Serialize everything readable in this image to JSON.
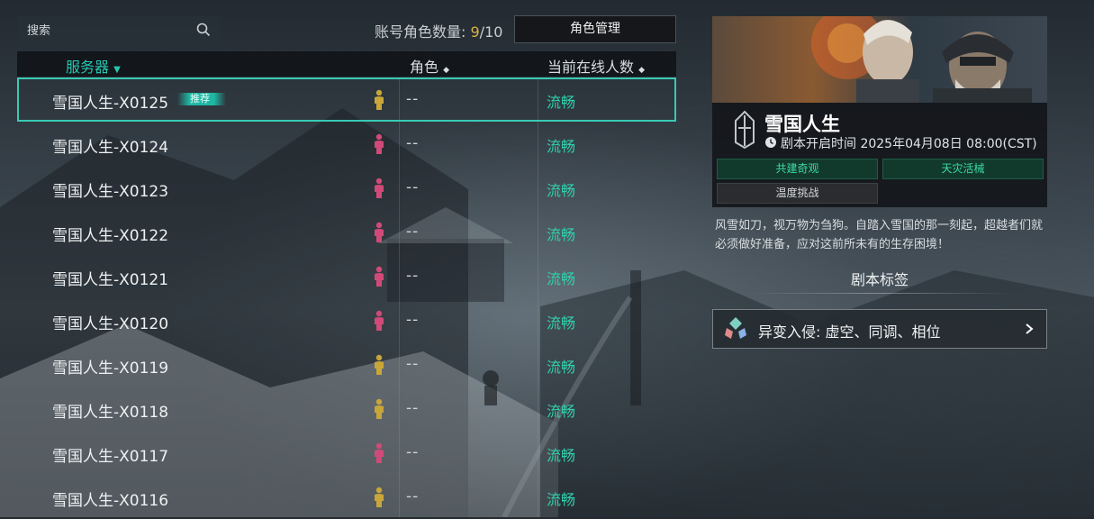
{
  "search": {
    "placeholder": "搜索"
  },
  "account": {
    "label": "账号角色数量: ",
    "current": "9",
    "sep": "/",
    "max": "10"
  },
  "manage_button": "角色管理",
  "table": {
    "headers": {
      "server": "服务器",
      "role": "角色",
      "online": "当前在线人数"
    },
    "rows": [
      {
        "name": "雪国人生-X0125",
        "tag": "推荐",
        "role": "--",
        "status": "流畅",
        "figure_color": "#c8a63a",
        "selected": true
      },
      {
        "name": "雪国人生-X0124",
        "tag": "",
        "role": "--",
        "status": "流畅",
        "figure_color": "#d04a78",
        "selected": false
      },
      {
        "name": "雪国人生-X0123",
        "tag": "",
        "role": "--",
        "status": "流畅",
        "figure_color": "#d04a78",
        "selected": false
      },
      {
        "name": "雪国人生-X0122",
        "tag": "",
        "role": "--",
        "status": "流畅",
        "figure_color": "#d04a78",
        "selected": false
      },
      {
        "name": "雪国人生-X0121",
        "tag": "",
        "role": "--",
        "status": "流畅",
        "figure_color": "#d04a78",
        "selected": false
      },
      {
        "name": "雪国人生-X0120",
        "tag": "",
        "role": "--",
        "status": "流畅",
        "figure_color": "#d04a78",
        "selected": false
      },
      {
        "name": "雪国人生-X0119",
        "tag": "",
        "role": "--",
        "status": "流畅",
        "figure_color": "#c8a63a",
        "selected": false
      },
      {
        "name": "雪国人生-X0118",
        "tag": "",
        "role": "--",
        "status": "流畅",
        "figure_color": "#c8a63a",
        "selected": false
      },
      {
        "name": "雪国人生-X0117",
        "tag": "",
        "role": "--",
        "status": "流畅",
        "figure_color": "#d04a78",
        "selected": false
      },
      {
        "name": "雪国人生-X0116",
        "tag": "",
        "role": "--",
        "status": "流畅",
        "figure_color": "#c8a63a",
        "selected": false
      }
    ]
  },
  "scenario": {
    "title": "雪国人生",
    "start_label": "剧本开启时间",
    "start_time": "2025年04月08日 08:00(CST)",
    "tags": [
      "共建奇观",
      "天灾活械",
      "温度挑战"
    ],
    "description": "风雪如刀，视万物为刍狗。自踏入雪国的那一刻起，超越者们就必须做好准备，应对这前所未有的生存困境！",
    "section_title": "剧本标签",
    "affix": "异变入侵: 虚空、同调、相位"
  },
  "colors": {
    "accent": "#27c7b0",
    "status_ok": "#2fd1ad",
    "count_highlight": "#d9b446"
  }
}
